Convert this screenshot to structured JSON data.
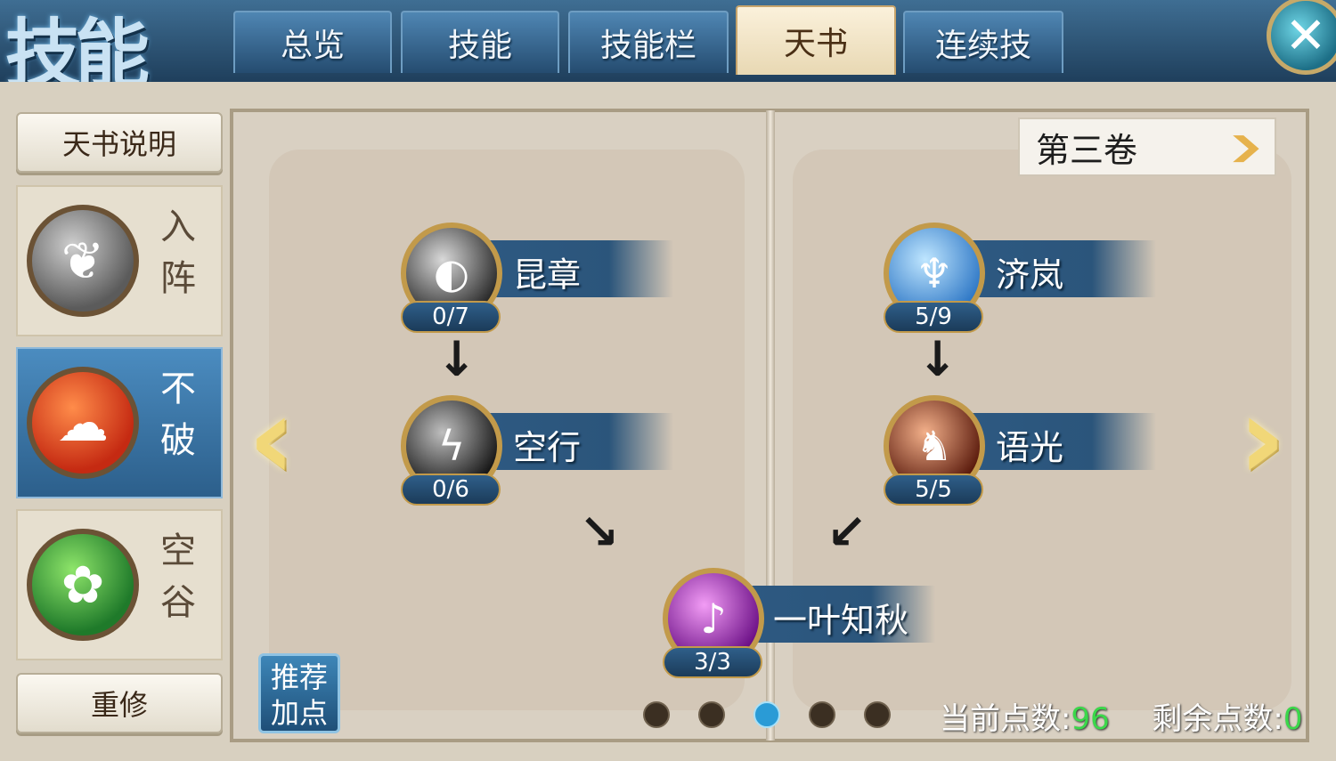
{
  "header": {
    "title": "技能",
    "tabs": [
      {
        "label": "总览",
        "active": false
      },
      {
        "label": "技能",
        "active": false
      },
      {
        "label": "技能栏",
        "active": false
      },
      {
        "label": "天书",
        "active": true
      },
      {
        "label": "连续技",
        "active": false
      }
    ],
    "close_icon": "close-x-icon"
  },
  "sidebar": {
    "info_button": "天书说明",
    "schools": [
      {
        "label": "入阵",
        "chars": [
          "入",
          "阵"
        ],
        "icon": "feather-icon",
        "active": false
      },
      {
        "label": "不破",
        "chars": [
          "不",
          "破"
        ],
        "icon": "cloud-icon",
        "active": true
      },
      {
        "label": "空谷",
        "chars": [
          "空",
          "谷"
        ],
        "icon": "lotus-icon",
        "active": false
      }
    ],
    "reset_button": "重修"
  },
  "book": {
    "volume_select": "第三卷",
    "skills": [
      {
        "name": "昆章",
        "points": "0/7",
        "icon": "orb-icon"
      },
      {
        "name": "空行",
        "points": "0/6",
        "icon": "lightning-icon"
      },
      {
        "name": "济岚",
        "points": "5/9",
        "icon": "spirit-figure-icon"
      },
      {
        "name": "语光",
        "points": "5/5",
        "icon": "flame-beast-icon"
      },
      {
        "name": "一叶知秋",
        "points": "3/3",
        "icon": "purple-leaf-icon"
      }
    ],
    "recommend_button": "推荐加点",
    "recommend_lines": [
      "推荐",
      "加点"
    ],
    "page_dots": {
      "total": 5,
      "current": 3
    }
  },
  "footer": {
    "current_points_label": "当前点数:",
    "current_points_value": "96",
    "remaining_points_label": "剩余点数:",
    "remaining_points_value": "0"
  },
  "colors": {
    "accent_blue": "#2b557b",
    "gold": "#c29a4a",
    "points_green": "#3bd84a"
  }
}
